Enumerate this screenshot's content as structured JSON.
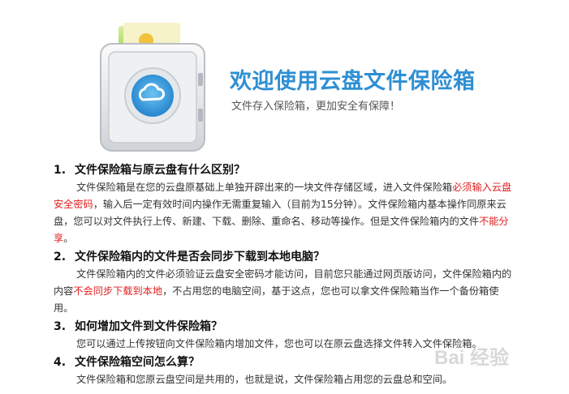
{
  "header": {
    "title": "欢迎使用云盘文件保险箱",
    "subtitle": "文件存入保险箱，更加安全有保障！"
  },
  "faq": [
    {
      "number": "1.",
      "question": "文件保险箱与原云盘有什么区别？",
      "answer_parts": [
        {
          "text": "文件保险箱是在您的云盘原基础上单独开辟出来的一块文件存储区域，进入文件保险箱",
          "highlight": false
        },
        {
          "text": "必须输入云盘安全密码",
          "highlight": true
        },
        {
          "text": "，输入后一定有效时间内操作无需重复输入（目前为15分钟）。文件保险箱内基本操作同原来云盘，您可以对文件执行上传、新建、下载、删除、重命名、移动等操作。但是文件保险箱内的文件",
          "highlight": false
        },
        {
          "text": "不能分享",
          "highlight": true
        },
        {
          "text": "。",
          "highlight": false
        }
      ]
    },
    {
      "number": "2.",
      "question": "文件保险箱内的文件是否会同步下载到本地电脑？",
      "answer_parts": [
        {
          "text": "文件保险箱内的文件必须验证云盘安全密码才能访问，目前您只能通过网页版访问，文件保险箱内的内容",
          "highlight": false
        },
        {
          "text": "不会同步下载到本地",
          "highlight": true
        },
        {
          "text": "，不占用您的电脑空间，基于这点，您也可以拿文件保险箱当作一个备份箱使用。",
          "highlight": false
        }
      ]
    },
    {
      "number": "3.",
      "question": "如何增加文件到文件保险箱？",
      "answer_parts": [
        {
          "text": "您可以通过上传按钮向文件保险箱内增加文件，您也可以在原云盘选择文件转入文件保险箱。",
          "highlight": false
        }
      ]
    },
    {
      "number": "4.",
      "question": "文件保险箱空间怎么算？",
      "answer_parts": [
        {
          "text": "文件保险箱和您原云盘空间是共用的，也就是说，文件保险箱占用您的云盘总和空间。",
          "highlight": false
        }
      ]
    }
  ],
  "colors": {
    "title_blue": "#2e8fd3",
    "highlight_red": "#e02020"
  },
  "icons": {
    "hero": "cloud-safe-icon",
    "watermark": "baidu-jingyan-watermark"
  },
  "watermark_text": "Bai 经验"
}
